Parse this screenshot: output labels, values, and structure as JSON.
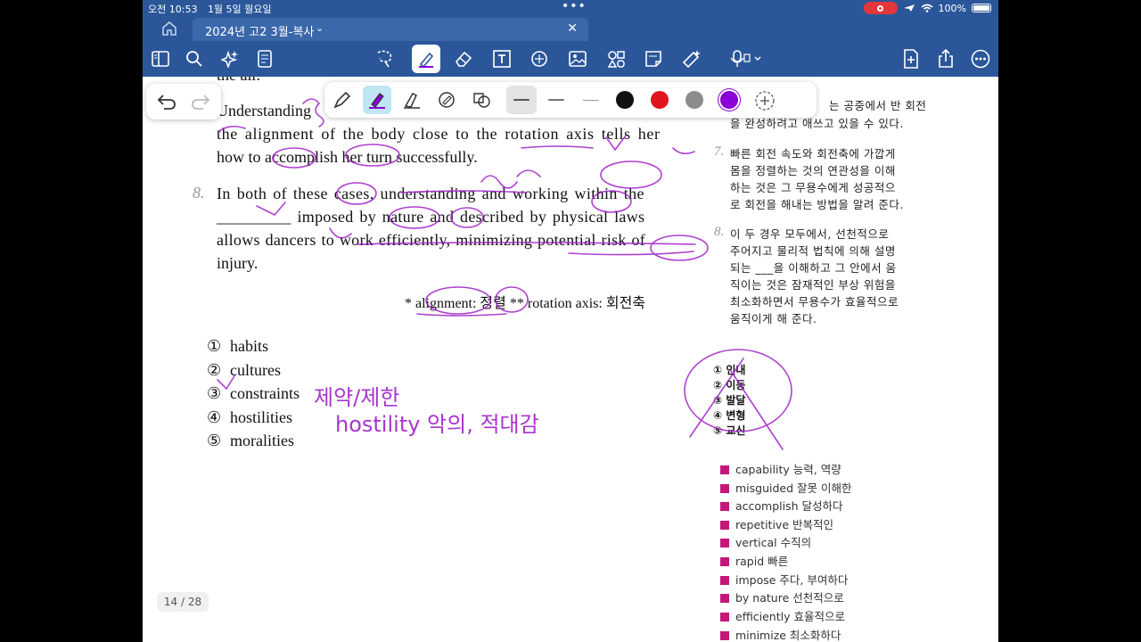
{
  "status": {
    "time": "오전 10:53",
    "date": "1월 5일 월요일",
    "battery": "100%"
  },
  "tab": {
    "title": "2024년 고2 3월-복사"
  },
  "toolbar": {
    "icons": [
      "sidebar-icon",
      "search-icon",
      "ai-sparkle-icon",
      "notes-icon",
      "lasso-icon",
      "highlighter-icon",
      "eraser-icon",
      "textbox-icon",
      "shapes-icon",
      "image-icon",
      "stickers-icon",
      "sticky-note-icon",
      "tape-icon",
      "microphone-icon",
      "add-page-icon",
      "share-icon",
      "more-icon"
    ]
  },
  "pen_palette": {
    "colors": [
      "#111111",
      "#e0161e",
      "#8c8c8c",
      "#8b00d4"
    ],
    "selected_color": "#8b00d4"
  },
  "english": {
    "line0": "the air.",
    "line1": "Understanding",
    "line2": "the alignment of the body close to the rotation axis tells her",
    "line3": "how to accomplish her turn successfully.",
    "q8_num": "8.",
    "q8_line1": "In both of these cases, understanding and working within the",
    "q8_line2": "_________ imposed by nature and described by physical laws",
    "q8_line3": "allows dancers to work efficiently, minimizing potential risk of",
    "q8_line4": "injury.",
    "footnote": "* alignment: 정렬 ** rotation axis: 회전축"
  },
  "korean": {
    "top1": "는 공중에서 반 회전",
    "top2": "을 완성하려고 애쓰고 있을 수 있다.",
    "q7_num": "7.",
    "q7": [
      "빠른 회전 속도와 회전축에 가깝게",
      "몸을 정렬하는 것의 연관성을 이해",
      "하는 것은 그 무용수에게 성공적으",
      "로 회전을 해내는 방법을 알려 준다."
    ],
    "q8_num": "8.",
    "q8": [
      "이 두 경우 모두에서, 선천적으로",
      "주어지고 물리적 법칙에 의해 설명",
      "되는 ___을 이해하고 그 안에서 움",
      "직이는 것은 잠재적인 부상 위험을",
      "최소화하면서 무용수가 효율적으로",
      "움직이게 해 준다."
    ]
  },
  "options": [
    {
      "num": "①",
      "text": "habits"
    },
    {
      "num": "②",
      "text": "cultures"
    },
    {
      "num": "③",
      "text": "constraints"
    },
    {
      "num": "④",
      "text": "hostilities"
    },
    {
      "num": "⑤",
      "text": "moralities"
    }
  ],
  "korean_options": [
    {
      "num": "①",
      "text": "인내"
    },
    {
      "num": "②",
      "text": "이동"
    },
    {
      "num": "③",
      "text": "발달"
    },
    {
      "num": "④",
      "text": "변형"
    },
    {
      "num": "⑤",
      "text": "교신"
    }
  ],
  "vocabulary": [
    "capability 능력, 역량",
    "misguided 잘못 이해한",
    "accomplish 달성하다",
    "repetitive 반복적인",
    "vertical 수직의",
    "rapid 빠른",
    "impose 주다, 부여하다",
    "by nature 선천적으로",
    "efficiently 효율적으로",
    "minimize 최소화하다"
  ],
  "handwriting": {
    "note1": "제약/제한",
    "note2": "hostility 악의, 적대감"
  },
  "page_indicator": "14 / 28"
}
